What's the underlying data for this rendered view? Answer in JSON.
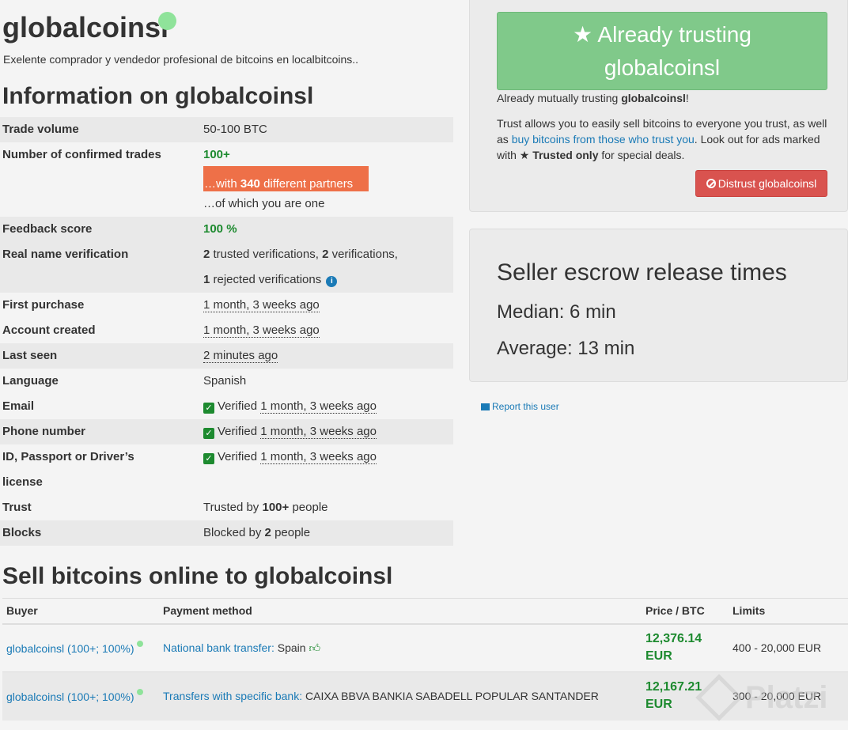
{
  "profile": {
    "username": "globalcoinsl",
    "bio": "Exelente comprador y vendedor profesional de bitcoins en localbitcoins..",
    "info_title": "Information on globalcoinsl"
  },
  "info": {
    "trade_volume": {
      "label": "Trade volume",
      "value": "50-100 BTC"
    },
    "confirmed_trades": {
      "label": "Number of confirmed trades",
      "value": "100+",
      "partners_prefix": "…with",
      "partners_count": "340",
      "partners_suffix": "different partners",
      "of_which": "…of which you are one"
    },
    "feedback": {
      "label": "Feedback score",
      "value": "100 %"
    },
    "real_name": {
      "label": "Real name verification",
      "trusted_count": "2",
      "trusted_text": "trusted verifications,",
      "verif_count": "2",
      "verif_text": "verifications,",
      "rejected_count": "1",
      "rejected_text": "rejected verifications"
    },
    "first_purchase": {
      "label": "First purchase",
      "value": "1 month, 3 weeks ago"
    },
    "account_created": {
      "label": "Account created",
      "value": "1 month, 3 weeks ago"
    },
    "last_seen": {
      "label": "Last seen",
      "value": "2 minutes ago"
    },
    "language": {
      "label": "Language",
      "value": "Spanish"
    },
    "email": {
      "label": "Email",
      "status": "Verified",
      "when": "1 month, 3 weeks ago"
    },
    "phone": {
      "label": "Phone number",
      "status": "Verified",
      "when": "1 month, 3 weeks ago"
    },
    "id_doc": {
      "label_line1": "ID, Passport or Driver’s",
      "label_line2": "license",
      "status": "Verified",
      "when": "1 month, 3 weeks ago"
    },
    "trust": {
      "label": "Trust",
      "prefix": "Trusted by",
      "count": "100+",
      "suffix": "people"
    },
    "blocks": {
      "label": "Blocks",
      "prefix": "Blocked by",
      "count": "2",
      "suffix": "people"
    }
  },
  "trust_panel": {
    "button_line1": "Already trusting",
    "button_line2": "globalcoinsl",
    "mutual_prefix": "Already mutually trusting",
    "mutual_user": "globalcoinsl",
    "mutual_suffix": "!",
    "text_1": "Trust allows you to easily sell bitcoins to everyone you trust, as well as",
    "link": "buy bitcoins from those who trust you",
    "text_2": ". Look out for ads marked with",
    "trusted_only": "Trusted only",
    "text_3": "for special deals.",
    "distrust_label": "Distrust globalcoinsl"
  },
  "escrow": {
    "title": "Seller escrow release times",
    "median": "Median: 6 min",
    "average": "Average: 13 min"
  },
  "report_label": "Report this user",
  "ads": {
    "title": "Sell bitcoins online to globalcoinsl",
    "headers": [
      "Buyer",
      "Payment method",
      "Price / BTC",
      "Limits"
    ],
    "rows": [
      {
        "buyer": "globalcoinsl (100+; 100%)",
        "method": "National bank transfer:",
        "method_detail": "Spain",
        "price": "12,376.14",
        "currency": "EUR",
        "limits": "400 - 20,000 EUR"
      },
      {
        "buyer": "globalcoinsl (100+; 100%)",
        "method": "Transfers with specific bank:",
        "method_detail": "CAIXA BBVA BANKIA SABADELL POPULAR SANTANDER",
        "price": "12,167.21",
        "currency": "EUR",
        "limits": "300 - 20,000 EUR"
      }
    ]
  },
  "watermark": "Platzi",
  "colors": {
    "accent_green": "#80c98a",
    "danger": "#d9534f",
    "link": "#1a7ab6",
    "highlight": "#ee7048"
  }
}
